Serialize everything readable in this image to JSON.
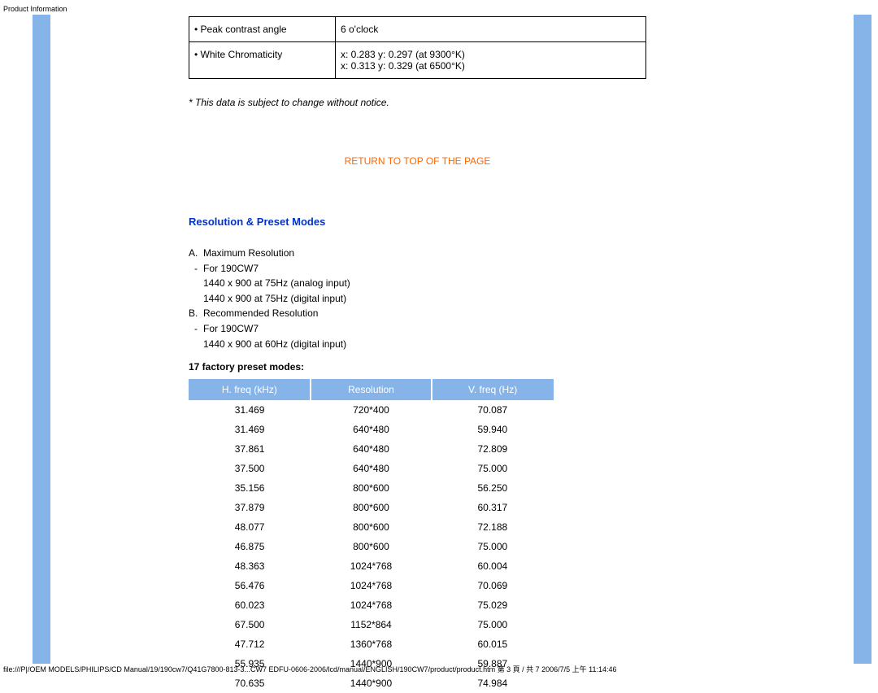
{
  "header": "Product Information",
  "spec_table": {
    "rows": [
      {
        "label": "•  Peak contrast angle",
        "value": "6 o'clock"
      },
      {
        "label": "•  White Chromaticity",
        "value": "x: 0.283 y: 0.297 (at 9300°K)\nx: 0.313 y: 0.329 (at 6500°K)"
      }
    ]
  },
  "disclaimer": "* This data is subject to change without notice.",
  "return_link": "RETURN TO TOP OF THE PAGE",
  "section_title": "Resolution & Preset Modes",
  "res_list": [
    {
      "marker": "A.",
      "text": "Maximum Resolution"
    },
    {
      "marker": "-",
      "text": "For 190CW7"
    },
    {
      "marker": "",
      "text": "1440 x 900 at 75Hz (analog input)"
    },
    {
      "marker": "",
      "text": "1440 x 900 at 75Hz (digital input)"
    },
    {
      "marker": "B.",
      "text": "Recommended Resolution"
    },
    {
      "marker": "-",
      "text": "For 190CW7"
    },
    {
      "marker": "",
      "text": "1440 x 900 at 60Hz (digital input)"
    }
  ],
  "preset_label": "17 factory preset modes:",
  "preset_headers": [
    "H. freq (kHz)",
    "Resolution",
    "V. freq (Hz)"
  ],
  "chart_data": {
    "type": "table",
    "columns": [
      "H. freq (kHz)",
      "Resolution",
      "V. freq (Hz)"
    ],
    "rows": [
      [
        "31.469",
        "720*400",
        "70.087"
      ],
      [
        "31.469",
        "640*480",
        "59.940"
      ],
      [
        "37.861",
        "640*480",
        "72.809"
      ],
      [
        "37.500",
        "640*480",
        "75.000"
      ],
      [
        "35.156",
        "800*600",
        "56.250"
      ],
      [
        "37.879",
        "800*600",
        "60.317"
      ],
      [
        "48.077",
        "800*600",
        "72.188"
      ],
      [
        "46.875",
        "800*600",
        "75.000"
      ],
      [
        "48.363",
        "1024*768",
        "60.004"
      ],
      [
        "56.476",
        "1024*768",
        "70.069"
      ],
      [
        "60.023",
        "1024*768",
        "75.029"
      ],
      [
        "67.500",
        "1152*864",
        "75.000"
      ],
      [
        "47.712",
        "1360*768",
        "60.015"
      ],
      [
        "55.935",
        "1440*900",
        "59.887"
      ],
      [
        "70.635",
        "1440*900",
        "74.984"
      ]
    ]
  },
  "footer": "file:///P|/OEM MODELS/PHILIPS/CD Manual/19/190cw7/Q41G7800-813-3...CW7 EDFU-0606-2006/lcd/manual/ENGLISH/190CW7/product/product.htm 第 3 頁 / 共 7 2006/7/5 上午 11:14:46"
}
